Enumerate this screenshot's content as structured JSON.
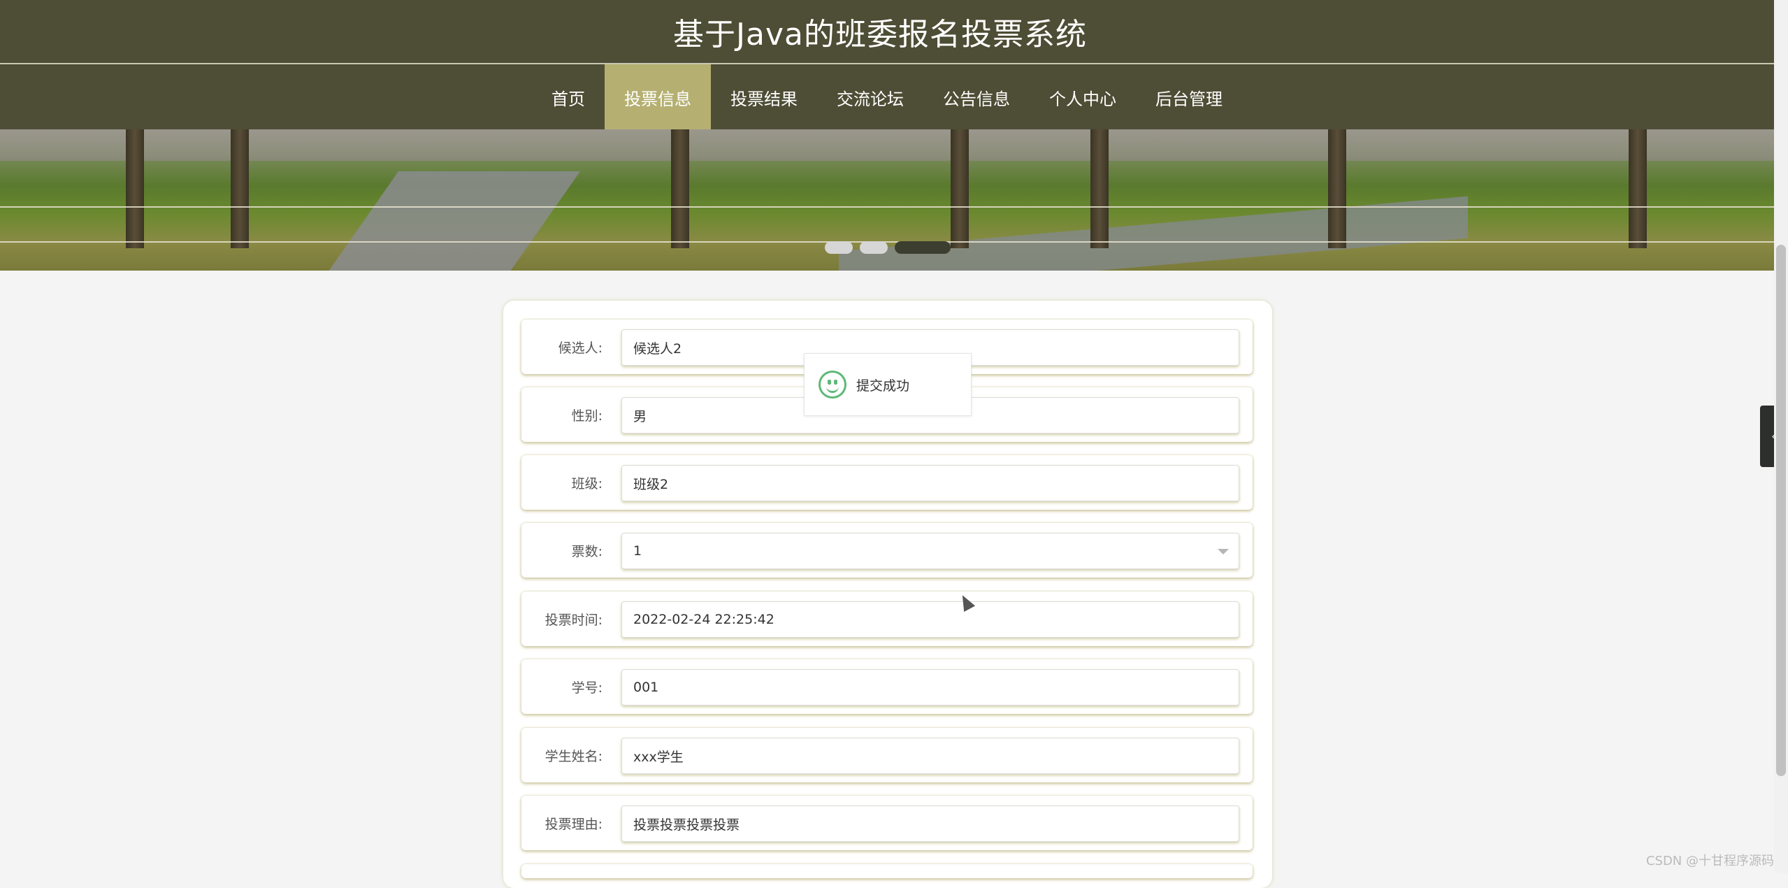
{
  "app": {
    "title": "基于Java的班委报名投票系统"
  },
  "nav": {
    "items": [
      {
        "label": "首页",
        "active": false
      },
      {
        "label": "投票信息",
        "active": true
      },
      {
        "label": "投票结果",
        "active": false
      },
      {
        "label": "交流论坛",
        "active": false
      },
      {
        "label": "公告信息",
        "active": false
      },
      {
        "label": "个人中心",
        "active": false
      },
      {
        "label": "后台管理",
        "active": false
      }
    ]
  },
  "carousel": {
    "slides": 3,
    "active_index": 2
  },
  "form": {
    "fields": [
      {
        "label": "候选人:",
        "value": "候选人2",
        "type": "text"
      },
      {
        "label": "性别:",
        "value": "男",
        "type": "text"
      },
      {
        "label": "班级:",
        "value": "班级2",
        "type": "text"
      },
      {
        "label": "票数:",
        "value": "1",
        "type": "select"
      },
      {
        "label": "投票时间:",
        "value": "2022-02-24 22:25:42",
        "type": "text"
      },
      {
        "label": "学号:",
        "value": "001",
        "type": "text"
      },
      {
        "label": "学生姓名:",
        "value": "xxx学生",
        "type": "text"
      },
      {
        "label": "投票理由:",
        "value": "投票投票投票投票",
        "type": "text"
      }
    ]
  },
  "toast": {
    "message": "提交成功",
    "icon": "smile-icon"
  },
  "side_handle": {
    "icon": "chevron-left-icon"
  },
  "watermark": "CSDN @十甘程序源码",
  "colors": {
    "header_bg": "#4e4d35",
    "nav_active": "#b5b072",
    "success": "#5fb878"
  }
}
